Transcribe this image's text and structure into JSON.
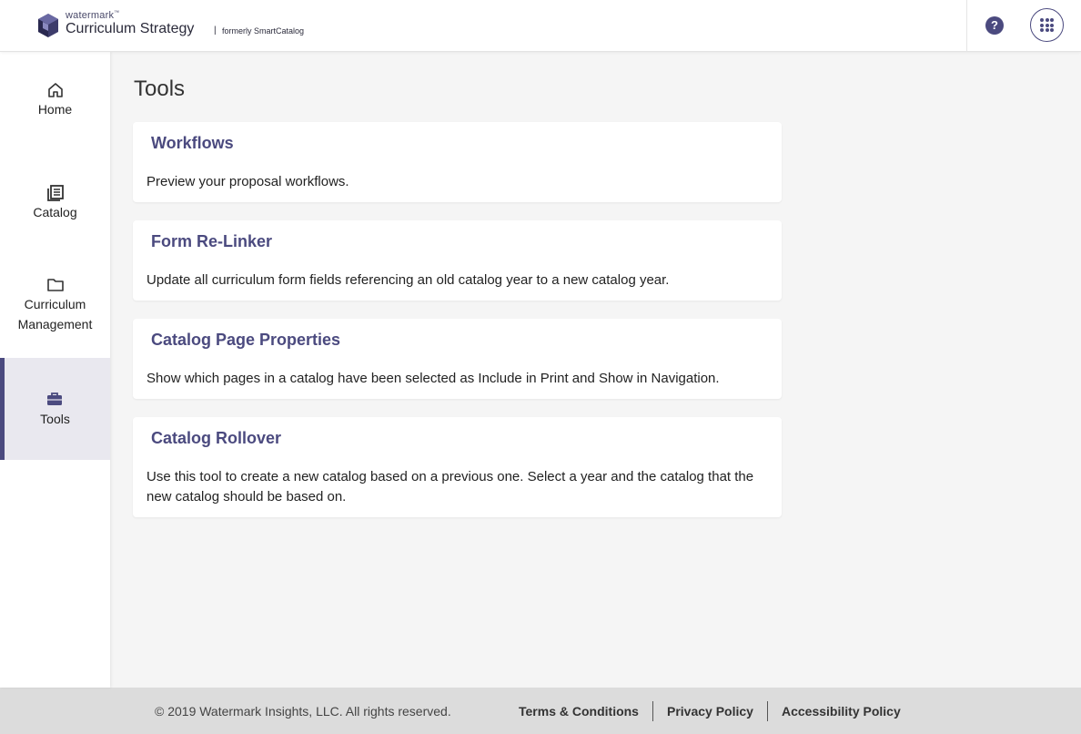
{
  "header": {
    "logo_brand": "watermark",
    "logo_tm": "™",
    "logo_product": "Curriculum Strategy",
    "logo_separator": "|",
    "logo_formerly": "formerly SmartCatalog",
    "help_label": "?",
    "accent_color": "#4b4a7f"
  },
  "sidebar": {
    "items": [
      {
        "label": "Home",
        "icon": "home-icon"
      },
      {
        "label": "Catalog",
        "icon": "catalog-icon"
      },
      {
        "label_line1": "Curriculum",
        "label_line2": "Management",
        "icon": "folder-icon"
      },
      {
        "label": "Tools",
        "icon": "toolbox-icon",
        "active": true
      }
    ]
  },
  "main": {
    "title": "Tools",
    "cards": [
      {
        "title": "Workflows",
        "description": "Preview your proposal workflows."
      },
      {
        "title": "Form Re-Linker",
        "description": "Update all curriculum form fields referencing an old catalog year to a new catalog year."
      },
      {
        "title": "Catalog Page Properties",
        "description": "Show which pages in a catalog have been selected as Include in Print and Show in Navigation."
      },
      {
        "title": "Catalog Rollover",
        "description": "Use this tool to create a new catalog based on a previous one. Select a year and the catalog that the new catalog should be based on."
      }
    ]
  },
  "footer": {
    "copyright": "© 2019 Watermark Insights, LLC. All rights reserved.",
    "links": [
      "Terms & Conditions",
      "Privacy Policy",
      "Accessibility Policy"
    ]
  }
}
